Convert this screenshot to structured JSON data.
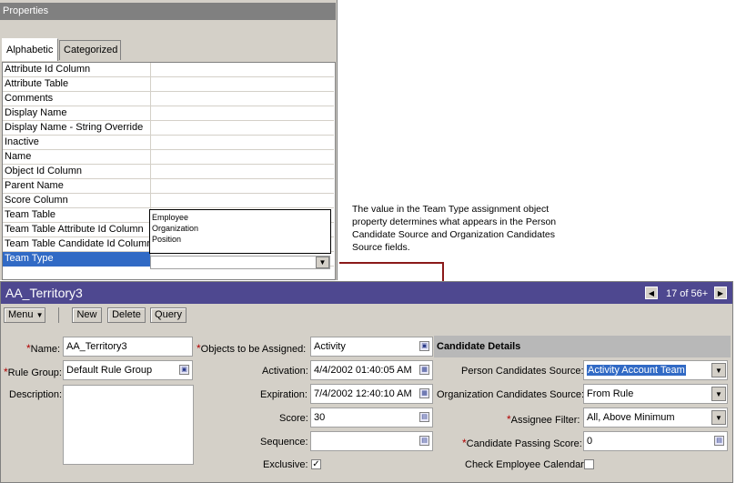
{
  "properties_panel": {
    "title": "Properties",
    "tabs": [
      {
        "label": "Alphabetic"
      },
      {
        "label": "Categorized"
      }
    ],
    "rows": [
      {
        "name": "Attribute Id Column"
      },
      {
        "name": "Attribute Table"
      },
      {
        "name": "Comments"
      },
      {
        "name": "Display Name"
      },
      {
        "name": "Display Name - String Override"
      },
      {
        "name": "Inactive"
      },
      {
        "name": "Name"
      },
      {
        "name": "Object Id Column"
      },
      {
        "name": "Parent Name"
      },
      {
        "name": "Score Column"
      },
      {
        "name": "Team Table"
      },
      {
        "name": "Team Table Attribute Id Column"
      },
      {
        "name": "Team Table Candidate Id Column"
      },
      {
        "name": "Team Type"
      }
    ],
    "team_type_options": [
      "Employee",
      "Organization",
      "Position"
    ]
  },
  "callout": {
    "text": "The value in the Team Type assignment object property determines what appears in the Person Candidate Source and Organization Candidates Source fields."
  },
  "territory_form": {
    "title": "AA_Territory3",
    "record_count": "17 of 56+",
    "toolbar": {
      "menu": "Menu",
      "new": "New",
      "delete": "Delete",
      "query": "Query"
    },
    "fields": {
      "name_label": "Name:",
      "name_value": "AA_Territory3",
      "rule_group_label": "Rule Group:",
      "rule_group_value": "Default Rule Group",
      "description_label": "Description:",
      "objects_label": "Objects to be Assigned:",
      "objects_value": "Activity",
      "activation_label": "Activation:",
      "activation_value": "4/4/2002 01:40:05 AM",
      "expiration_label": "Expiration:",
      "expiration_value": "7/4/2002 12:40:10 AM",
      "score_label": "Score:",
      "score_value": "30",
      "sequence_label": "Sequence:",
      "exclusive_label": "Exclusive:",
      "candidate_header": "Candidate Details",
      "person_source_label": "Person Candidates Source:",
      "person_source_value": "Activity Account Team",
      "org_source_label": "Organization Candidates Source:",
      "org_source_value": "From Rule",
      "assignee_filter_label": "Assignee Filter:",
      "assignee_filter_value": "All, Above Minimum",
      "passing_score_label": "Candidate Passing Score:",
      "passing_score_value": "0",
      "check_calendar_label": "Check Employee Calendar:"
    },
    "colors": {
      "header_bg": "#4e4890",
      "selection": "#316ac5",
      "required": "#b00000",
      "callout_line": "#8b1a1a"
    }
  }
}
